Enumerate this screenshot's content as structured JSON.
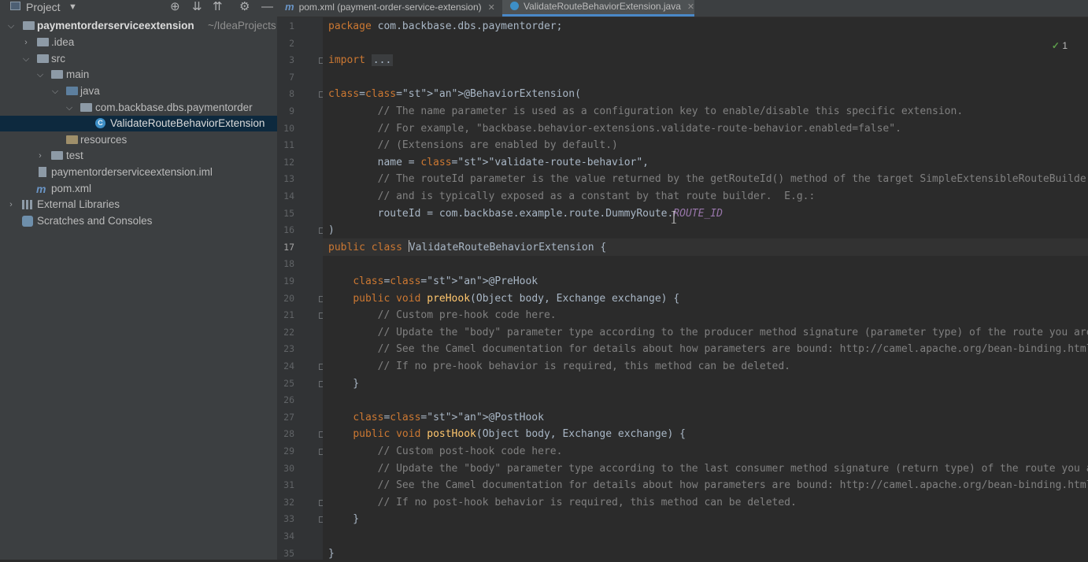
{
  "project_panel": {
    "title": "Project",
    "tree": [
      {
        "label": "paymentorderserviceextension",
        "suffix": "~/IdeaProjects",
        "icon": "folder-icon",
        "expanded": true
      },
      {
        "label": ".idea",
        "icon": "folder-icon",
        "expanded": false
      },
      {
        "label": "src",
        "icon": "folder-icon",
        "expanded": true
      },
      {
        "label": "main",
        "icon": "folder-icon",
        "expanded": true
      },
      {
        "label": "java",
        "icon": "source-folder-icon",
        "expanded": true
      },
      {
        "label": "com.backbase.dbs.paymentorder",
        "icon": "package-icon",
        "expanded": true
      },
      {
        "label": "ValidateRouteBehaviorExtension",
        "icon": "java-class-icon",
        "selected": true
      },
      {
        "label": "resources",
        "icon": "resources-folder-icon"
      },
      {
        "label": "test",
        "icon": "folder-icon",
        "expanded": false
      },
      {
        "label": "paymentorderserviceextension.iml",
        "icon": "iml-file-icon"
      },
      {
        "label": "pom.xml",
        "icon": "maven-icon"
      },
      {
        "label": "External Libraries",
        "icon": "library-icon",
        "expanded": false
      },
      {
        "label": "Scratches and Consoles",
        "icon": "scratches-icon"
      }
    ]
  },
  "tabs": [
    {
      "label": "pom.xml (payment-order-service-extension)",
      "icon": "maven-icon",
      "active": false
    },
    {
      "label": "ValidateRouteBehaviorExtension.java",
      "icon": "java-class-icon",
      "active": true
    }
  ],
  "inspection": {
    "count": "1"
  },
  "editor": {
    "current_line": 17,
    "lines": [
      {
        "n": "1",
        "text": "package com.backbase.dbs.paymentorder;"
      },
      {
        "n": "2",
        "text": ""
      },
      {
        "n": "3",
        "text": "import ..."
      },
      {
        "n": "7",
        "text": ""
      },
      {
        "n": "8",
        "text": "@BehaviorExtension("
      },
      {
        "n": "9",
        "text": "        // The name parameter is used as a configuration key to enable/disable this specific extension."
      },
      {
        "n": "10",
        "text": "        // For example, \"backbase.behavior-extensions.validate-route-behavior.enabled=false\"."
      },
      {
        "n": "11",
        "text": "        // (Extensions are enabled by default.)"
      },
      {
        "n": "12",
        "text": "        name = \"validate-route-behavior\","
      },
      {
        "n": "13",
        "text": "        // The routeId parameter is the value returned by the getRouteId() method of the target SimpleExtensibleRouteBuilder"
      },
      {
        "n": "14",
        "text": "        // and is typically exposed as a constant by that route builder.  E.g.:"
      },
      {
        "n": "15",
        "text": "        routeId = com.backbase.example.route.DummyRoute.ROUTE_ID"
      },
      {
        "n": "16",
        "text": ")"
      },
      {
        "n": "17",
        "text": "public class ValidateRouteBehaviorExtension {"
      },
      {
        "n": "18",
        "text": ""
      },
      {
        "n": "19",
        "text": "    @PreHook"
      },
      {
        "n": "20",
        "text": "    public void preHook(Object body, Exchange exchange) {"
      },
      {
        "n": "21",
        "text": "        // Custom pre-hook code here."
      },
      {
        "n": "22",
        "text": "        // Update the \"body\" parameter type according to the producer method signature (parameter type) of the route you are extending."
      },
      {
        "n": "23",
        "text": "        // See the Camel documentation for details about how parameters are bound: http://camel.apache.org/bean-binding.html"
      },
      {
        "n": "24",
        "text": "        // If no pre-hook behavior is required, this method can be deleted."
      },
      {
        "n": "25",
        "text": "    }"
      },
      {
        "n": "26",
        "text": ""
      },
      {
        "n": "27",
        "text": "    @PostHook"
      },
      {
        "n": "28",
        "text": "    public void postHook(Object body, Exchange exchange) {"
      },
      {
        "n": "29",
        "text": "        // Custom post-hook code here."
      },
      {
        "n": "30",
        "text": "        // Update the \"body\" parameter type according to the last consumer method signature (return type) of the route you are extending."
      },
      {
        "n": "31",
        "text": "        // See the Camel documentation for details about how parameters are bound: http://camel.apache.org/bean-binding.html"
      },
      {
        "n": "32",
        "text": "        // If no post-hook behavior is required, this method can be deleted."
      },
      {
        "n": "33",
        "text": "    }"
      },
      {
        "n": "34",
        "text": ""
      },
      {
        "n": "35",
        "text": "}"
      }
    ]
  }
}
